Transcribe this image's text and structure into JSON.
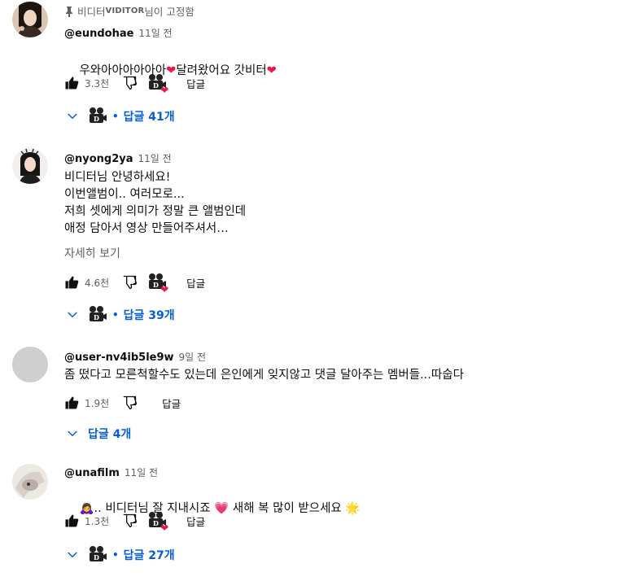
{
  "comments": [
    {
      "pinned_label": "비디터",
      "pinned_brand": "VIDITOR",
      "pinned_suffix": "님이 고정함",
      "author": "@eundohae",
      "time": "11일 전",
      "text": "우와아아아아아아",
      "text_mid": "달려왔어요 갓비터",
      "likes": "3.3천",
      "reply_label": "답글",
      "replies_label": "답글 41개"
    },
    {
      "author": "@nyong2ya",
      "time": "11일 전",
      "text": "비디터님 안녕하세요!\n이번앨범이.. 여러모로...\n저희 셋에게 의미가 정말 큰 앨범인데\n애정 담아서 영상 만들어주셔서…",
      "more": "자세히 보기",
      "likes": "4.6천",
      "reply_label": "답글",
      "replies_label": "답글 39개"
    },
    {
      "author": "@user-nv4ib5le9w",
      "time": "9일 전",
      "text": "좀 떴다고 모른척할수도 있는데 은인에게 잊지않고 댓글 달아주는 멤버들...따숩다",
      "likes": "1.9천",
      "reply_label": "답글",
      "replies_label": "답글 4개"
    },
    {
      "author": "@unafilm",
      "time": "11일 전",
      "text_a": ".. 비디터님 잘 지내시죠",
      "text_b": "새해 복 많이 받으세요",
      "likes": "1.3천",
      "reply_label": "답글",
      "replies_label": "답글 27개"
    }
  ],
  "colors": {
    "link": "#065fd4",
    "muted": "#606060",
    "heart": "#e8184b"
  },
  "icons": [
    "pin-icon",
    "like-icon",
    "dislike-icon",
    "creator-heart-badge",
    "chevron-down-icon"
  ]
}
